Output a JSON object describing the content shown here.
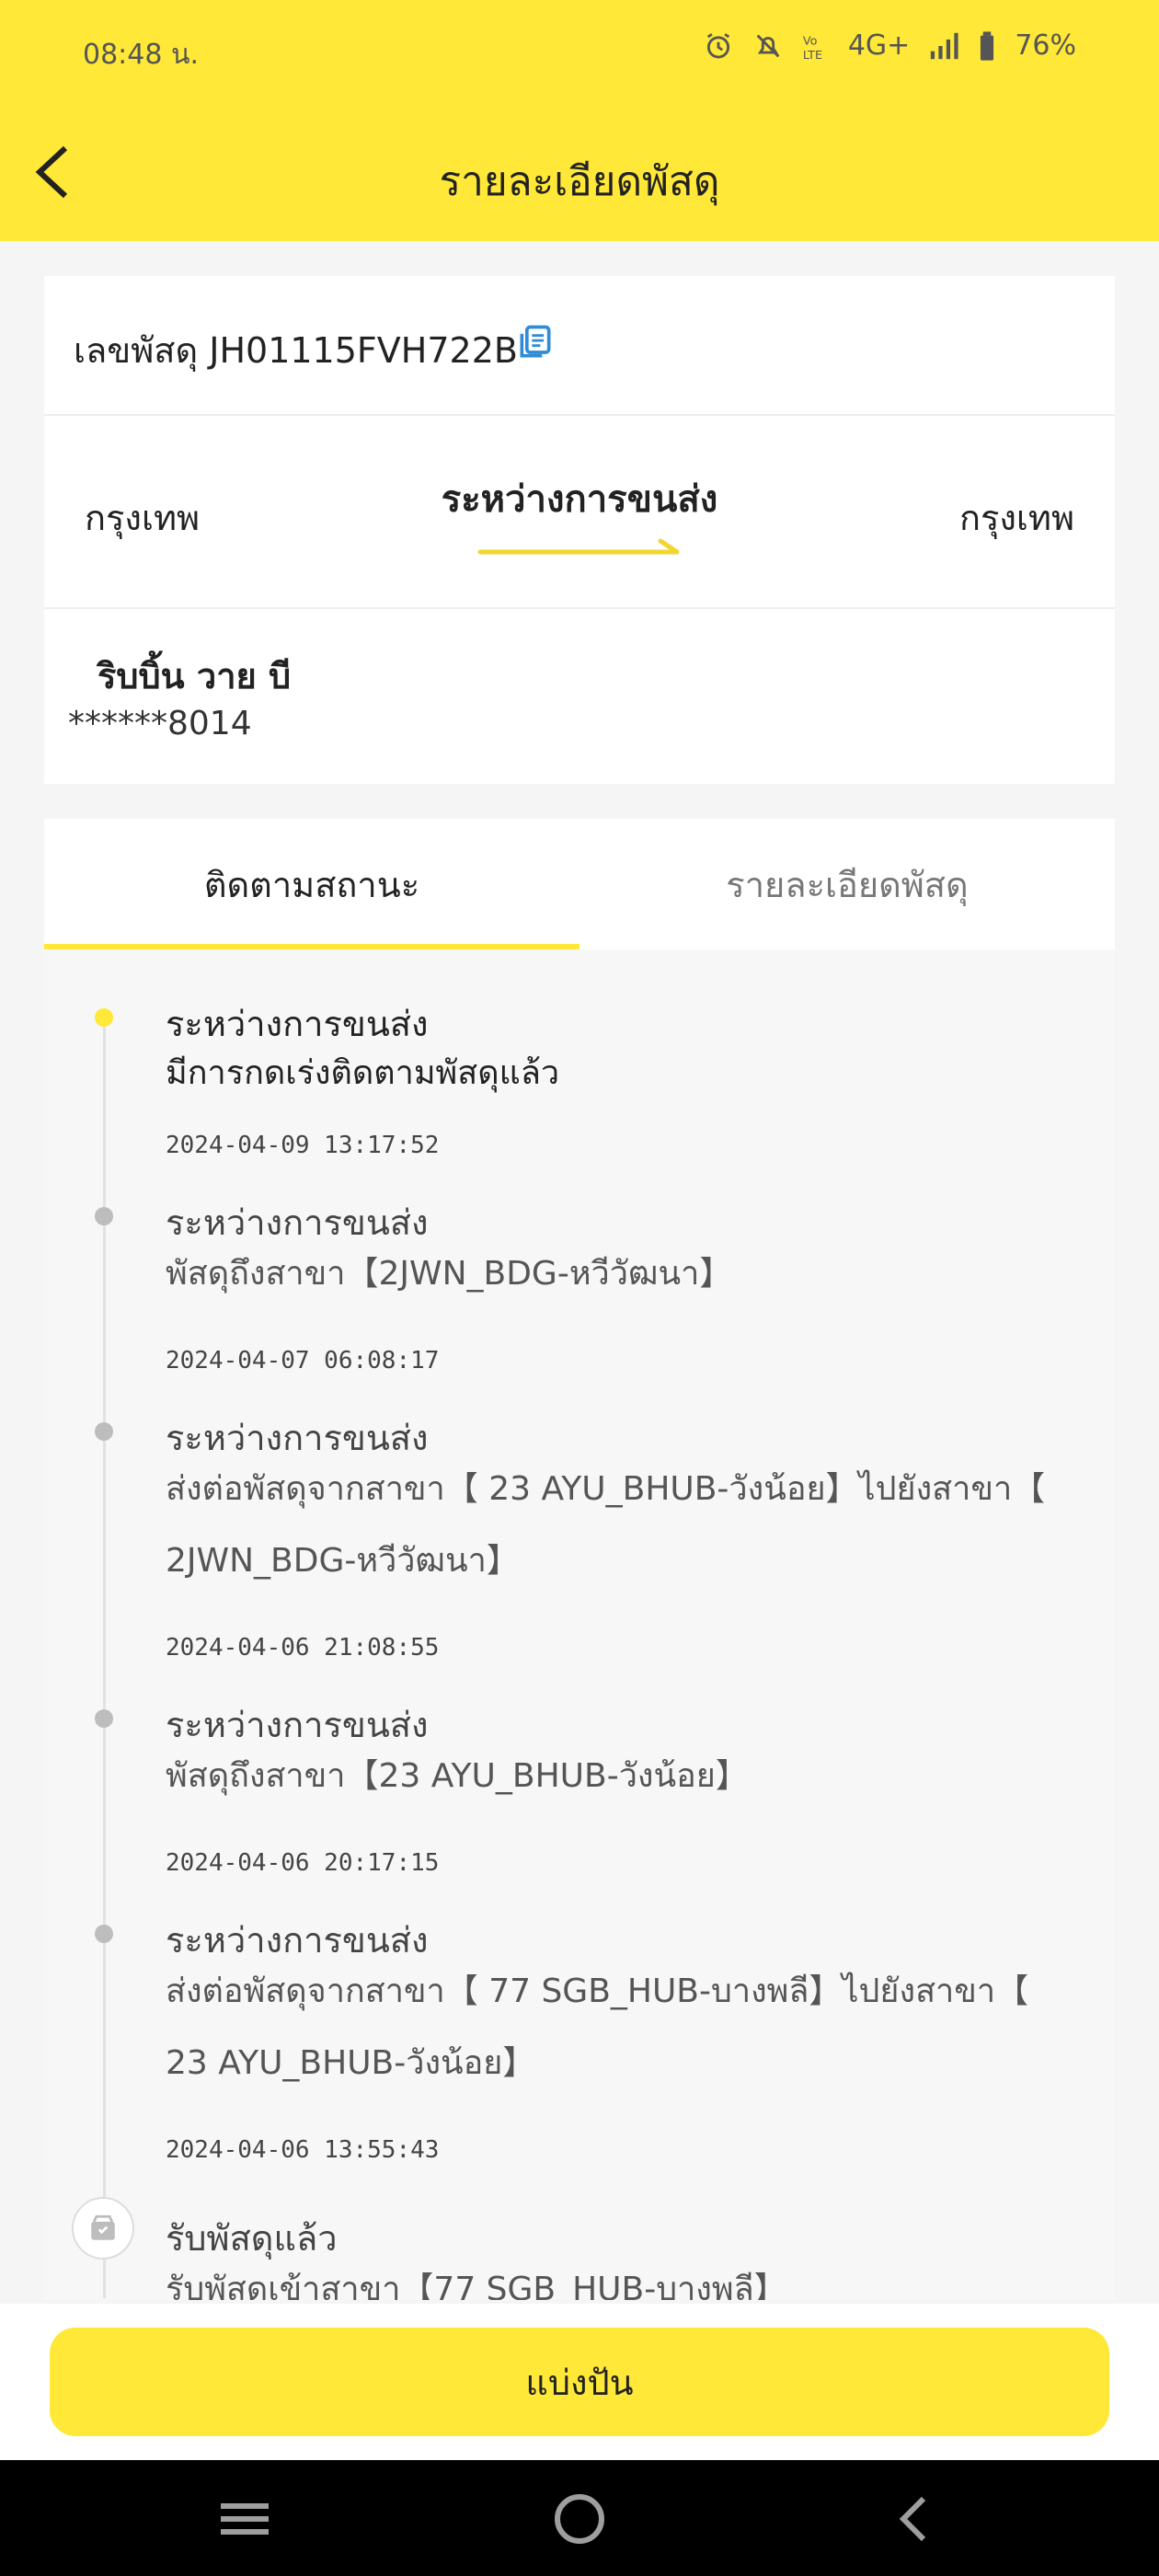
{
  "status_bar": {
    "time": "08:48 น.",
    "network": "4G+",
    "battery": "76%"
  },
  "header": {
    "title": "รายละเอียดพัสดุ"
  },
  "parcel": {
    "tracking_text": "เลขพัสดุ JH01115FVH722B",
    "from_city": "กรุงเทพ",
    "to_city": "กรุงเทพ",
    "status": "ระหว่างการขนส่ง",
    "receiver_name": "ริบบิ้น วาย บี",
    "receiver_phone": "******8014"
  },
  "tabs": {
    "track": "ติดตามสถานะ",
    "details": "รายละเอียดพัสดุ"
  },
  "timeline": [
    {
      "title": "ระหว่างการขนส่ง",
      "desc": "มีการกดเร่งติดตามพัสดุแล้ว",
      "time": "2024-04-09 13:17:52"
    },
    {
      "title": "ระหว่างการขนส่ง",
      "desc": "พัสดุถึงสาขา【2JWN_BDG-หวีวัฒนา】",
      "time": "2024-04-07 06:08:17"
    },
    {
      "title": "ระหว่างการขนส่ง",
      "desc": "ส่งต่อพัสดุจากสาขา【 23 AYU_BHUB-วังน้อย】ไปยังสาขา【 2JWN_BDG-หวีวัฒนา】",
      "time": "2024-04-06 21:08:55"
    },
    {
      "title": "ระหว่างการขนส่ง",
      "desc": "พัสดุถึงสาขา【23 AYU_BHUB-วังน้อย】",
      "time": "2024-04-06 20:17:15"
    },
    {
      "title": "ระหว่างการขนส่ง",
      "desc": "ส่งต่อพัสดุจากสาขา【 77 SGB_HUB-บางพลี】ไปยังสาขา【 23 AYU_BHUB-วังน้อย】",
      "time": "2024-04-06 13:55:43"
    },
    {
      "title": "รับพัสดุแล้ว",
      "desc": "รับพัสดุเข้าสาขา【77 SGB_HUB-บางพลี】",
      "time": ""
    }
  ],
  "actions": {
    "share": "แบ่งปัน"
  },
  "colors": {
    "brand": "#ffe837",
    "copy_icon": "#2f8cd6"
  },
  "icons": [
    "alarm-icon",
    "mute-icon",
    "volte-icon",
    "signal-icon",
    "battery-icon",
    "back-arrow-icon",
    "copy-icon",
    "route-arrow-icon",
    "package-icon",
    "nav-recents-icon",
    "nav-home-icon",
    "nav-back-icon"
  ]
}
